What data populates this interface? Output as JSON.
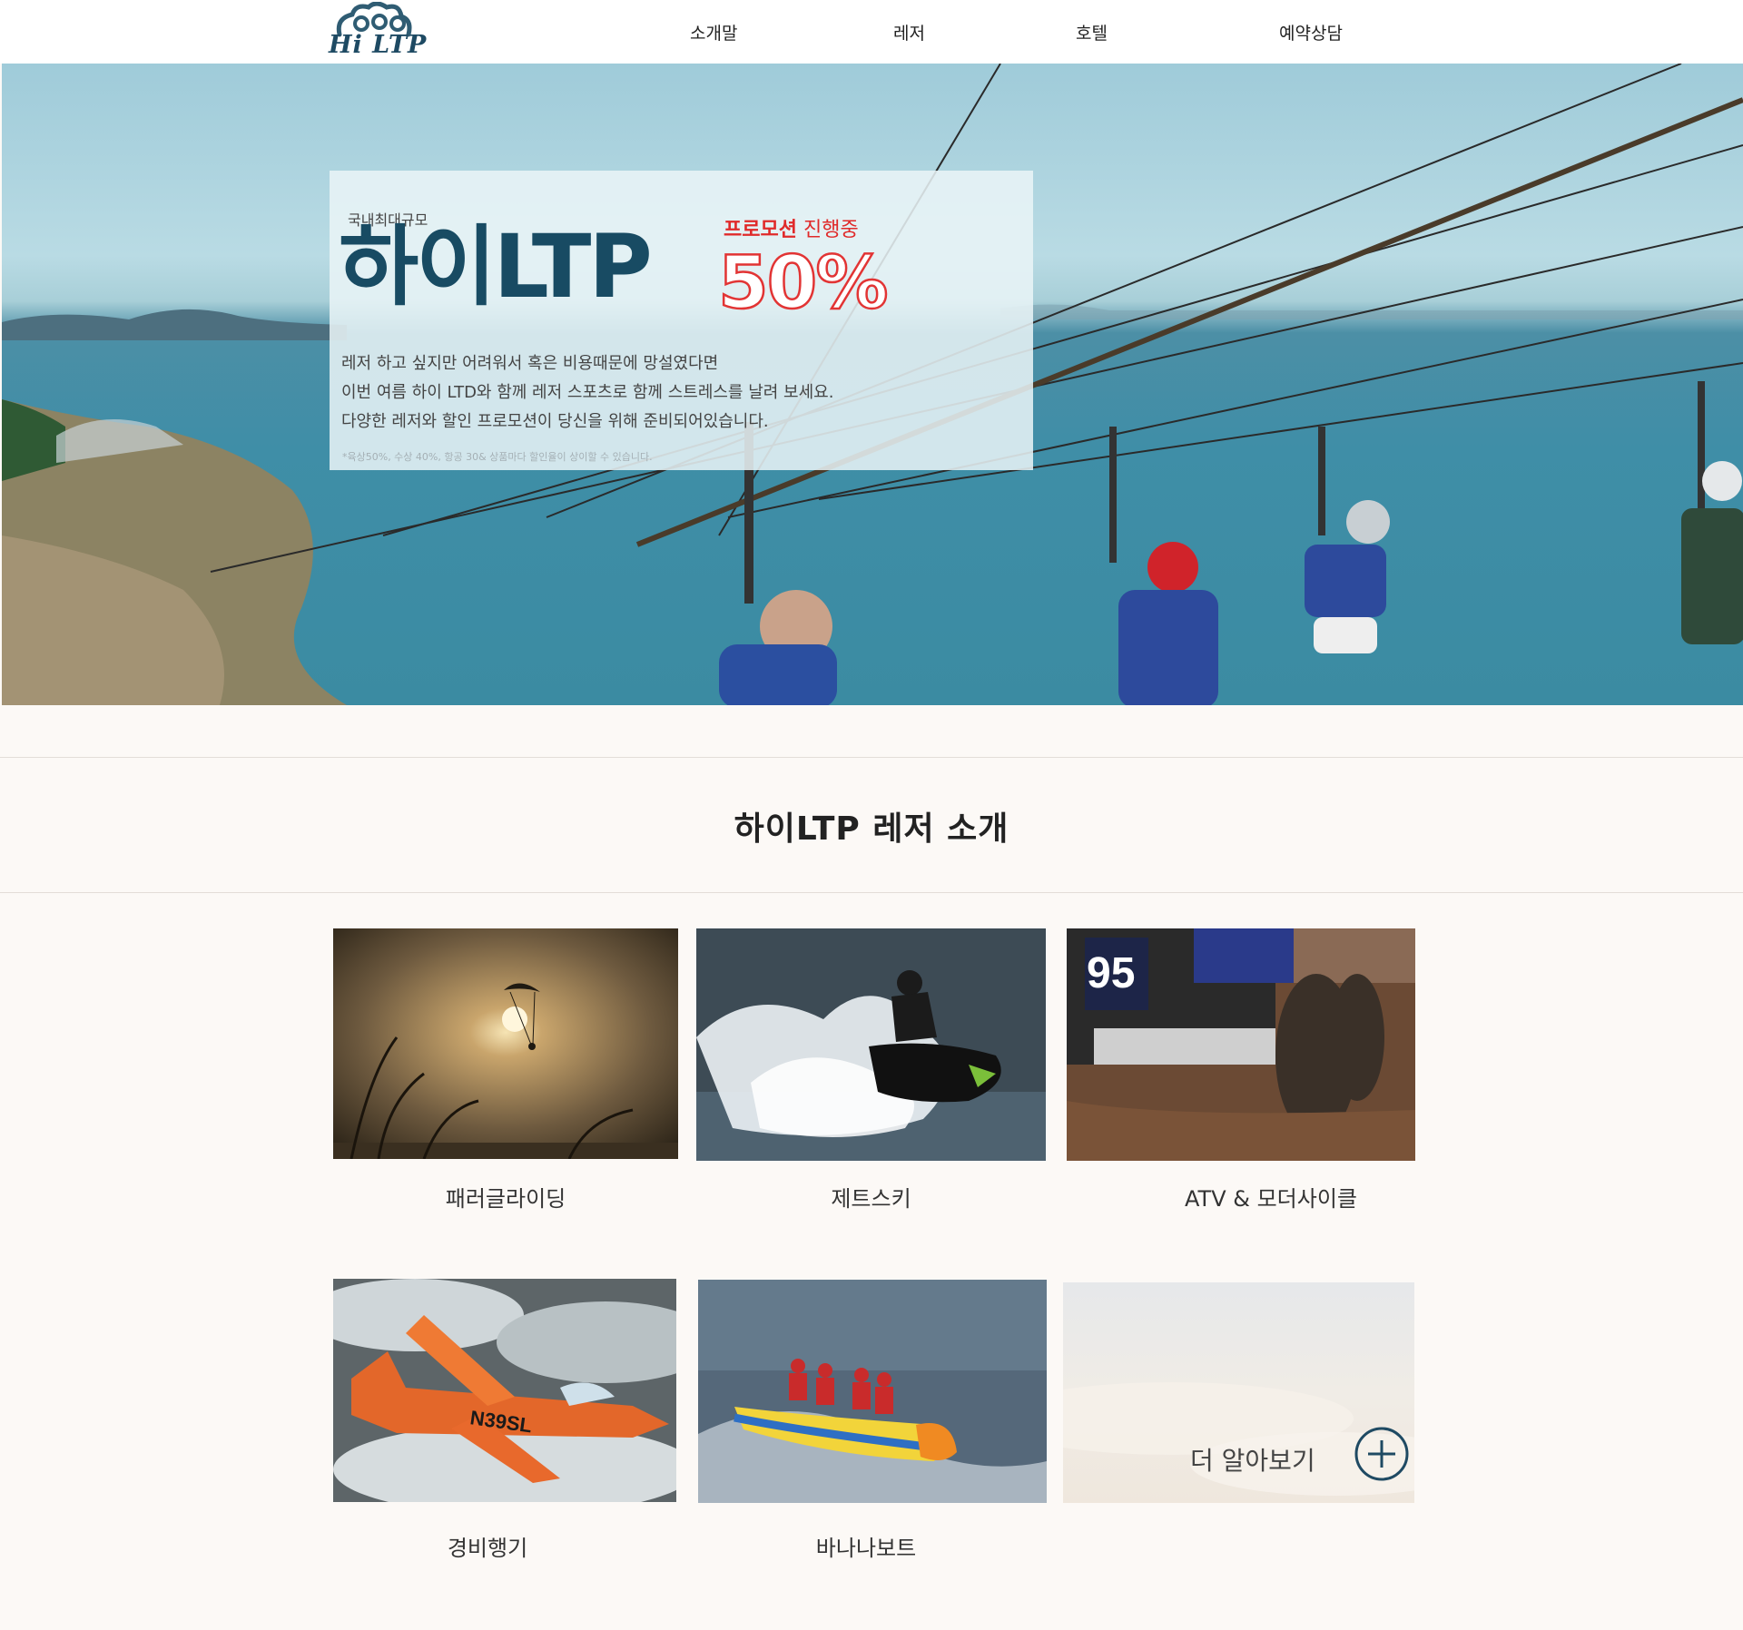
{
  "header": {
    "logo_text": "Hi LTP",
    "nav": [
      "소개말",
      "레저",
      "호텔",
      "예약상담"
    ]
  },
  "hero": {
    "small_label": "국내최대규모",
    "brand": "하이LTP",
    "promo_strong": "프로모션",
    "promo_normal": " 진행중",
    "discount": "50%",
    "lines": [
      "레저 하고 싶지만 어려워서 혹은 비용때문에 망설였다면",
      "이번 여름 하이 LTD와 함께 레저 스포츠로 함께 스트레스를 날려 보세요.",
      "다양한 레저와 할인 프로모션이 당신을 위해 준비되어있습니다."
    ],
    "note": "*육상50%, 수상 40%, 항공 30& 상품마다 할인율이 상이할 수 있습니다."
  },
  "section": {
    "title": "하이LTP 레저 소개"
  },
  "cards": [
    {
      "label": "패러글라이딩"
    },
    {
      "label": "제트스키"
    },
    {
      "label": "ATV & 모더사이클"
    },
    {
      "label": "경비행기"
    },
    {
      "label": "바나나보트"
    }
  ],
  "more": {
    "label": "더 알아보기",
    "icon": "plus-circle-icon"
  },
  "colors": {
    "brand": "#184b63",
    "accent": "#e02a2a",
    "background": "#fcf9f6"
  }
}
